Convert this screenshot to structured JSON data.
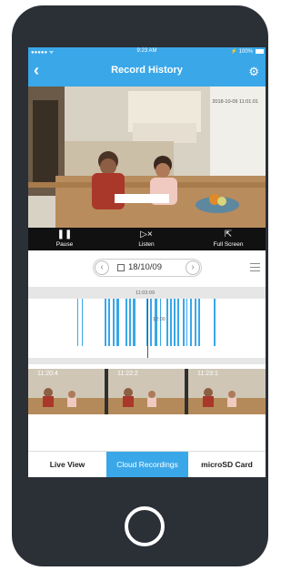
{
  "status_bar": {
    "carrier": "●●●●● ᯤ",
    "time": "9:23 AM",
    "battery": "⚡ 100%"
  },
  "header": {
    "title": "Record History",
    "back_icon": "chevron-left-icon",
    "settings_icon": "gear-icon"
  },
  "video": {
    "timestamp": "2018-10-09 11:01:01"
  },
  "controls": {
    "pause_label": "Pause",
    "listen_label": "Listen",
    "fullscreen_label": "Full Screen"
  },
  "date_picker": {
    "date": "18/10/09"
  },
  "timeline": {
    "cursor_time": "11:03:09",
    "marker_time": "12:00"
  },
  "thumbnails": [
    {
      "time": "11:20:4"
    },
    {
      "time": "11:22:2"
    },
    {
      "time": "11:23:1"
    }
  ],
  "tabs": [
    {
      "label": "Live View"
    },
    {
      "label": "Cloud Recordings"
    },
    {
      "label": "microSD Card"
    }
  ],
  "colors": {
    "accent": "#3aa7e8",
    "phone_body": "#2b2f36"
  }
}
